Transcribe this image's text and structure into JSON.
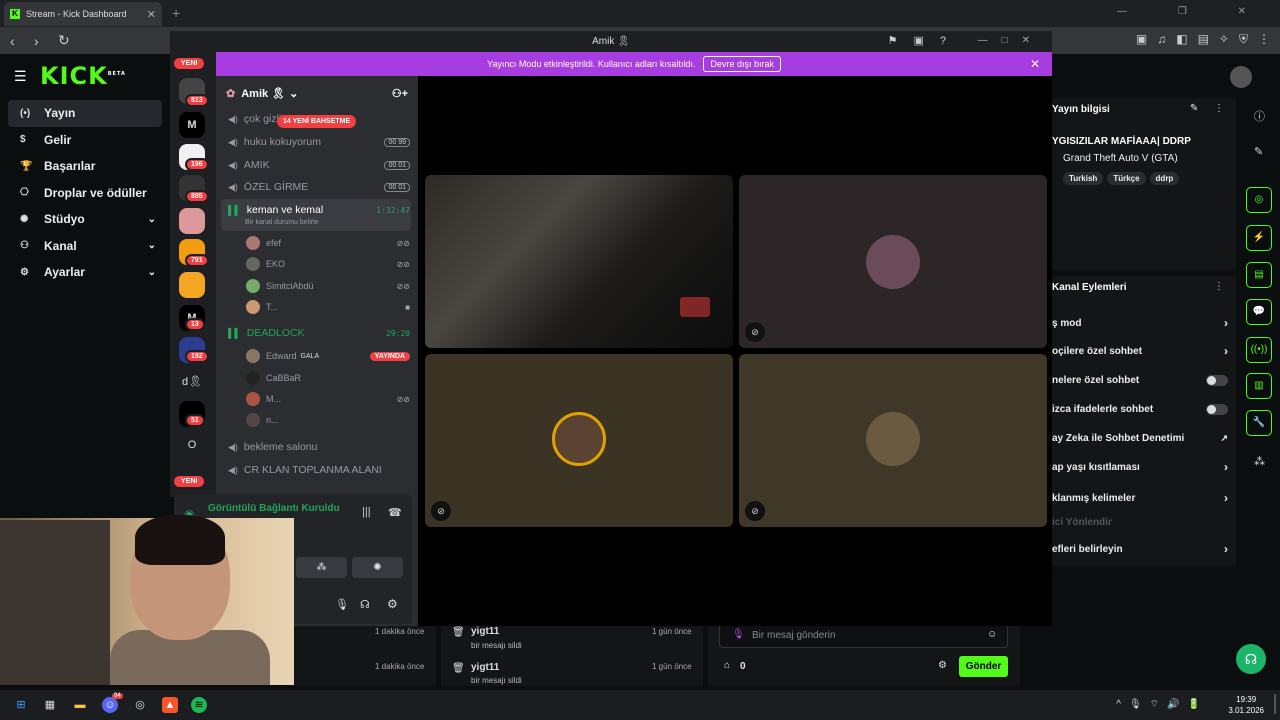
{
  "browser": {
    "tab_title": "Stream - Kick Dashboard",
    "new_tab": "+",
    "window_controls": "— ❐ ✕"
  },
  "kick": {
    "logo": "KICK",
    "logo_sup": "BETA",
    "nav": [
      {
        "label": "Yayın",
        "icon": "broadcast-icon"
      },
      {
        "label": "Gelir",
        "icon": "dollar-icon"
      },
      {
        "label": "Başarılar",
        "icon": "trophy-icon"
      },
      {
        "label": "Droplar ve ödüller",
        "icon": "gift-icon"
      },
      {
        "label": "Stüdyo",
        "icon": "gear-icon"
      },
      {
        "label": "Kanal",
        "icon": "user-icon"
      },
      {
        "label": "Ayarlar",
        "icon": "gear-icon"
      }
    ]
  },
  "discord": {
    "window_title": "Amik 🎗",
    "servers": [
      {
        "badge": "YENI"
      },
      {
        "badge": "813"
      },
      {
        "badge": ""
      },
      {
        "badge": "196"
      },
      {
        "badge": "885"
      },
      {
        "badge": ""
      },
      {
        "badge": "791"
      },
      {
        "badge": ""
      },
      {
        "badge": "13"
      },
      {
        "badge": "192"
      },
      {
        "label": "d🎗"
      },
      {
        "badge": "51"
      },
      {
        "label": "O"
      },
      {
        "badge": "YENI"
      }
    ],
    "banner": {
      "text": "Yayıncı Modu etkinleştirildi. Kullanıcı adları kısaltıldı.",
      "button": "Devre dışı bırak"
    },
    "server_name": "Amik 🎗",
    "mention": "14 YENİ BAHSETME",
    "channels": [
      {
        "name": "çok gizli",
        "count": ""
      },
      {
        "name": "huku kokuyorum",
        "count": "00 99"
      },
      {
        "name": "AMIK",
        "count": "00 01"
      },
      {
        "name": "ÖZEL GİRME",
        "count": "00 01"
      },
      {
        "name": "keman ve kemal",
        "timer": "1:32:47",
        "status": "Bir kanal durumu belirle"
      },
      {
        "name": "DEADLOCK",
        "timer": "29:20"
      },
      {
        "name": "bekleme salonu"
      },
      {
        "name": "CR KLAN TOPLANMA ALANI"
      }
    ],
    "users_keman": [
      "efef",
      "EKO",
      "SimitciAbdü",
      "T..."
    ],
    "users_deadlock": [
      {
        "name": "Edward",
        "tag": "GALA",
        "live": "YAYINDA"
      },
      {
        "name": "CaBBaR"
      },
      {
        "name": "M..."
      },
      {
        "name": "n..."
      }
    ],
    "voice_status": "Görüntülü Bağlantı Kuruldu"
  },
  "right": {
    "info_title": "Yayın bilgisi",
    "stream_title": "YGISIZILAR MAFİAAA| DDRP",
    "game": "Grand Theft Auto V (GTA)",
    "tags": [
      "Turkish",
      "Türkçe",
      "ddrp"
    ],
    "actions_title": "Kanal Eylemleri",
    "actions": [
      {
        "label": "ş mod",
        "kind": "arrow"
      },
      {
        "label": "oçilere özel sohbet",
        "kind": "arrow"
      },
      {
        "label": "nelere özel sohbet",
        "kind": "toggle"
      },
      {
        "label": "izca ifadelerle sohbet",
        "kind": "toggle"
      },
      {
        "label": "ay Zeka ile Sohbet Denetimi",
        "kind": "ext"
      },
      {
        "label": "ap yaşı kısıtlaması",
        "kind": "arrow"
      },
      {
        "label": "klanmış kelimeler",
        "kind": "arrow"
      },
      {
        "label": "ici Yönlendir",
        "kind": "muted"
      },
      {
        "label": "efleri belirleyin",
        "kind": "arrow"
      }
    ]
  },
  "bottom": {
    "time1": "1 dakika önce",
    "time2": "1 dakika önce",
    "log": [
      {
        "user": "yigt11",
        "action": "bir mesajı sildi",
        "time": "1 gün önce"
      },
      {
        "user": "yigt11",
        "action": "bir mesajı sildi",
        "time": "1 gün önce"
      }
    ],
    "chat_placeholder": "Bir mesaj gönderin",
    "points": "0",
    "send": "Gönder"
  },
  "taskbar": {
    "time": "19:39",
    "date": "3.01.2026",
    "discord_badge": "94"
  }
}
